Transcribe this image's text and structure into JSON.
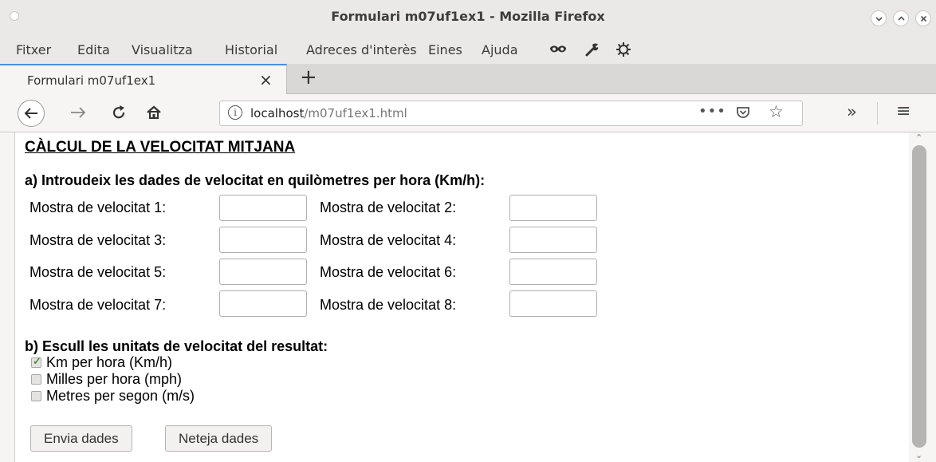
{
  "window": {
    "title": "Formulari m07uf1ex1 - Mozilla Firefox"
  },
  "menu": {
    "items": [
      "Fitxer",
      "Edita",
      "Visualitza",
      "Historial",
      "Adreces d'interès",
      "Eines",
      "Ajuda"
    ]
  },
  "tab": {
    "label": "Formulari m07uf1ex1",
    "close": "×",
    "new_tab": "+"
  },
  "nav": {
    "url_host": "localhost",
    "url_path": "/m07uf1ex1.html",
    "more": "•••",
    "overflow": "»",
    "menu": "≡"
  },
  "page": {
    "heading": "CÀLCUL DE LA VELOCITAT MITJANA",
    "section_a": "a) Introudeix les dades de velocitat en quilòmetres per hora (Km/h):",
    "samples": [
      "Mostra de velocitat 1:",
      "Mostra de velocitat 2:",
      "Mostra de velocitat 3:",
      "Mostra de velocitat 4:",
      "Mostra de velocitat 5:",
      "Mostra de velocitat 6:",
      "Mostra de velocitat 7:",
      "Mostra de velocitat 8:"
    ],
    "section_b": "b) Escull les unitats de velocitat del resultat:",
    "units": [
      {
        "label": "Km per hora (Km/h)",
        "checked": true
      },
      {
        "label": "Milles per hora (mph)",
        "checked": false
      },
      {
        "label": "Metres per segon (m/s)",
        "checked": false
      }
    ],
    "submit_label": "Envia dades",
    "reset_label": "Neteja dades"
  },
  "colors": {
    "tab_accent": "#4a90d9",
    "check_green": "#4f8f3a"
  },
  "icons": [
    "back-arrow-icon",
    "forward-arrow-icon",
    "reload-icon",
    "home-icon",
    "info-icon",
    "pocket-icon",
    "bookmark-star-icon",
    "mask-icon",
    "wrench-icon",
    "gear-icon"
  ]
}
